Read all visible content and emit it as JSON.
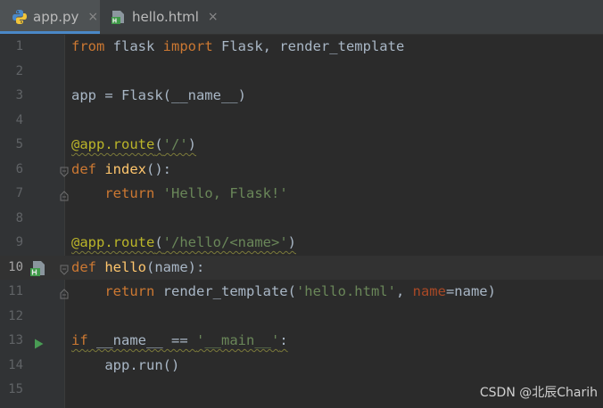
{
  "tabs": [
    {
      "label": "app.py",
      "icon": "python-file-icon",
      "active": true
    },
    {
      "label": "hello.html",
      "icon": "html-file-icon",
      "active": false
    }
  ],
  "tab_close_glyph": "×",
  "line_numbers": [
    "1",
    "2",
    "3",
    "4",
    "5",
    "6",
    "7",
    "8",
    "9",
    "10",
    "11",
    "12",
    "13",
    "14",
    "15"
  ],
  "code": {
    "l1_kw_from": "from",
    "l1_mod": " flask ",
    "l1_kw_import": "import",
    "l1_rest": " Flask, render_template",
    "l3_text": "app = Flask(__name__)",
    "l5_deco": "@app.route",
    "l5_open": "(",
    "l5_str": "'/'",
    "l5_close": ")",
    "l6_kw": "def",
    "l6_fn": "index",
    "l6_rest": "():",
    "l7_indent": "    ",
    "l7_kw": "return",
    "l7_str": "'Hello, Flask!'",
    "l9_deco": "@app.route",
    "l9_open": "(",
    "l9_str": "'/hello/<name>'",
    "l9_close": ")",
    "l10_kw": "def",
    "l10_fn": "hello",
    "l10_rest": "(name):",
    "l11_indent": "    ",
    "l11_kw": "return",
    "l11_mid": " render_template(",
    "l11_str": "'hello.html'",
    "l11_comma": ", ",
    "l11_param": "name",
    "l11_end": "=name)",
    "l13_kw": "if",
    "l13_mid": " __name__ == ",
    "l13_str": "'__main__'",
    "l13_colon": ":",
    "l14_text": "    app.run()"
  },
  "gutter_icons": {
    "line10": "html-template-link-icon",
    "line13": "run-arrow-icon"
  },
  "watermark": "CSDN @北辰Charih",
  "colors": {
    "background": "#2b2b2b",
    "gutter": "#313335",
    "keyword": "#cc7832",
    "string": "#6a8759",
    "decorator": "#bbb529",
    "function": "#ffc66d",
    "parameter": "#aa4926",
    "default_text": "#a9b7c6"
  }
}
